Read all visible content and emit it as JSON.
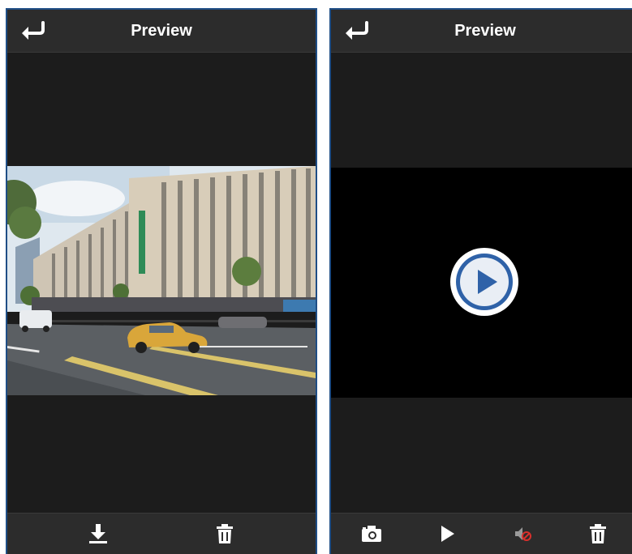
{
  "left_screen": {
    "title": "Preview",
    "back_icon": "back-arrow-icon",
    "content": "photo",
    "toolbar": {
      "items": [
        {
          "icon": "download-icon"
        },
        {
          "icon": "trash-icon"
        }
      ]
    }
  },
  "right_screen": {
    "title": "Preview",
    "back_icon": "back-arrow-icon",
    "content": "video",
    "toolbar": {
      "items": [
        {
          "icon": "camera-icon"
        },
        {
          "icon": "play-icon"
        },
        {
          "icon": "mute-icon"
        },
        {
          "icon": "trash-icon"
        }
      ]
    }
  },
  "colors": {
    "screen_bg": "#1c1c1c",
    "bar_bg": "#2c2c2c",
    "frame_border": "#1f4e86",
    "play_button_blue": "#2f62a8",
    "mute_accent": "#d8302c",
    "taxi_yellow": "#d9a63a"
  }
}
